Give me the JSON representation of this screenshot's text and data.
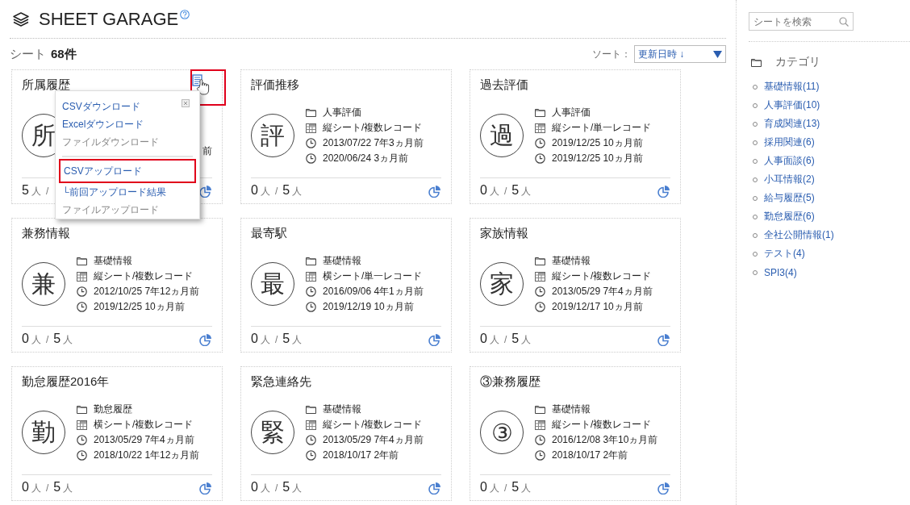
{
  "header": {
    "title": "SHEET GARAGE"
  },
  "summary": {
    "label": "シート",
    "count": "68件"
  },
  "sort": {
    "label": "ソート：",
    "value": "更新日時 ↓"
  },
  "cards": [
    {
      "title": "所属履歴",
      "initial": "所",
      "menu_open": true,
      "trigger_highlighted": true,
      "meta": [
        {
          "kind": "blank"
        },
        {
          "kind": "blank"
        },
        {
          "kind": "fragment",
          "text": "前"
        }
      ],
      "footer": [
        {
          "kind": "number",
          "text": "5"
        },
        {
          "kind": "unit",
          "text": "人"
        },
        {
          "kind": "unit",
          "text": "/"
        }
      ]
    },
    {
      "title": "評価推移",
      "initial": "評",
      "menu_open": false,
      "meta": [
        {
          "kind": "category",
          "text": "人事評価"
        },
        {
          "kind": "sheet",
          "text": "縦シート/複数レコード"
        },
        {
          "kind": "date",
          "text": "2013/07/22 7年3ヵ月前"
        },
        {
          "kind": "date",
          "text": "2020/06/24 3ヵ月前"
        }
      ],
      "footer": [
        {
          "kind": "number",
          "text": "0"
        },
        {
          "kind": "unit",
          "text": "人"
        },
        {
          "kind": "unit",
          "text": "/"
        },
        {
          "kind": "number",
          "text": "5"
        },
        {
          "kind": "unit",
          "text": "人"
        }
      ]
    },
    {
      "title": "過去評価",
      "initial": "過",
      "menu_open": false,
      "meta": [
        {
          "kind": "category",
          "text": "人事評価"
        },
        {
          "kind": "sheet",
          "text": "縦シート/単一レコード"
        },
        {
          "kind": "date",
          "text": "2019/12/25 10ヵ月前"
        },
        {
          "kind": "date",
          "text": "2019/12/25 10ヵ月前"
        }
      ],
      "footer": [
        {
          "kind": "number",
          "text": "0"
        },
        {
          "kind": "unit",
          "text": "人"
        },
        {
          "kind": "unit",
          "text": "/"
        },
        {
          "kind": "number",
          "text": "5"
        },
        {
          "kind": "unit",
          "text": "人"
        }
      ]
    },
    {
      "title": "兼務情報",
      "initial": "兼",
      "menu_open": false,
      "meta": [
        {
          "kind": "category",
          "text": "基礎情報"
        },
        {
          "kind": "sheet",
          "text": "縦シート/複数レコード"
        },
        {
          "kind": "date",
          "text": "2012/10/25 7年12ヵ月前"
        },
        {
          "kind": "date",
          "text": "2019/12/25 10ヵ月前"
        }
      ],
      "footer": [
        {
          "kind": "number",
          "text": "0"
        },
        {
          "kind": "unit",
          "text": "人"
        },
        {
          "kind": "unit",
          "text": "/"
        },
        {
          "kind": "number",
          "text": "5"
        },
        {
          "kind": "unit",
          "text": "人"
        }
      ]
    },
    {
      "title": "最寄駅",
      "initial": "最",
      "menu_open": false,
      "meta": [
        {
          "kind": "category",
          "text": "基礎情報"
        },
        {
          "kind": "sheet",
          "text": "横シート/単一レコード"
        },
        {
          "kind": "date",
          "text": "2016/09/06 4年1ヵ月前"
        },
        {
          "kind": "date",
          "text": "2019/12/19 10ヵ月前"
        }
      ],
      "footer": [
        {
          "kind": "number",
          "text": "0"
        },
        {
          "kind": "unit",
          "text": "人"
        },
        {
          "kind": "unit",
          "text": "/"
        },
        {
          "kind": "number",
          "text": "5"
        },
        {
          "kind": "unit",
          "text": "人"
        }
      ]
    },
    {
      "title": "家族情報",
      "initial": "家",
      "menu_open": false,
      "meta": [
        {
          "kind": "category",
          "text": "基礎情報"
        },
        {
          "kind": "sheet",
          "text": "縦シート/複数レコード"
        },
        {
          "kind": "date",
          "text": "2013/05/29 7年4ヵ月前"
        },
        {
          "kind": "date",
          "text": "2019/12/17 10ヵ月前"
        }
      ],
      "footer": [
        {
          "kind": "number",
          "text": "0"
        },
        {
          "kind": "unit",
          "text": "人"
        },
        {
          "kind": "unit",
          "text": "/"
        },
        {
          "kind": "number",
          "text": "5"
        },
        {
          "kind": "unit",
          "text": "人"
        }
      ]
    },
    {
      "title": "勤怠履歴2016年",
      "initial": "勤",
      "menu_open": false,
      "meta": [
        {
          "kind": "category",
          "text": "勤怠履歴"
        },
        {
          "kind": "sheet",
          "text": "横シート/複数レコード"
        },
        {
          "kind": "date",
          "text": "2013/05/29 7年4ヵ月前"
        },
        {
          "kind": "date",
          "text": "2018/10/22 1年12ヵ月前"
        }
      ],
      "footer": [
        {
          "kind": "number",
          "text": "0"
        },
        {
          "kind": "unit",
          "text": "人"
        },
        {
          "kind": "unit",
          "text": "/"
        },
        {
          "kind": "number",
          "text": "5"
        },
        {
          "kind": "unit",
          "text": "人"
        }
      ]
    },
    {
      "title": "緊急連絡先",
      "initial": "緊",
      "menu_open": false,
      "meta": [
        {
          "kind": "category",
          "text": "基礎情報"
        },
        {
          "kind": "sheet",
          "text": "縦シート/複数レコード"
        },
        {
          "kind": "date",
          "text": "2013/05/29 7年4ヵ月前"
        },
        {
          "kind": "date",
          "text": "2018/10/17 2年前"
        }
      ],
      "footer": [
        {
          "kind": "number",
          "text": "0"
        },
        {
          "kind": "unit",
          "text": "人"
        },
        {
          "kind": "unit",
          "text": "/"
        },
        {
          "kind": "number",
          "text": "5"
        },
        {
          "kind": "unit",
          "text": "人"
        }
      ]
    },
    {
      "title": "③兼務履歴",
      "initial": "③",
      "menu_open": false,
      "meta": [
        {
          "kind": "category",
          "text": "基礎情報"
        },
        {
          "kind": "sheet",
          "text": "縦シート/複数レコード"
        },
        {
          "kind": "date",
          "text": "2016/12/08 3年10ヵ月前"
        },
        {
          "kind": "date",
          "text": "2018/10/17 2年前"
        }
      ],
      "footer": [
        {
          "kind": "number",
          "text": "0"
        },
        {
          "kind": "unit",
          "text": "人"
        },
        {
          "kind": "unit",
          "text": "/"
        },
        {
          "kind": "number",
          "text": "5"
        },
        {
          "kind": "unit",
          "text": "人"
        }
      ]
    }
  ],
  "file_menu": {
    "items": [
      {
        "kind": "link",
        "text": "CSVダウンロード",
        "highlighted": false
      },
      {
        "kind": "link",
        "text": "Excelダウンロード",
        "highlighted": false
      },
      {
        "kind": "disabled",
        "text": "ファイルダウンロード",
        "highlighted": false
      },
      {
        "kind": "divider"
      },
      {
        "kind": "link",
        "text": "CSVアップロード",
        "highlighted": true
      },
      {
        "kind": "link",
        "text": "└前回アップロード結果",
        "highlighted": false
      },
      {
        "kind": "disabled",
        "text": "ファイルアップロード",
        "highlighted": false
      }
    ]
  },
  "sidebar": {
    "search": {
      "placeholder": "シートを検索"
    },
    "heading": "カテゴリ",
    "categories": [
      "基礎情報(11)",
      "人事評価(10)",
      "育成関連(13)",
      "採用関連(6)",
      "人事面談(6)",
      "小耳情報(2)",
      "給与履歴(5)",
      "勤怠履歴(6)",
      "全社公開情報(1)",
      "テスト(4)",
      "SPI3(4)"
    ]
  }
}
